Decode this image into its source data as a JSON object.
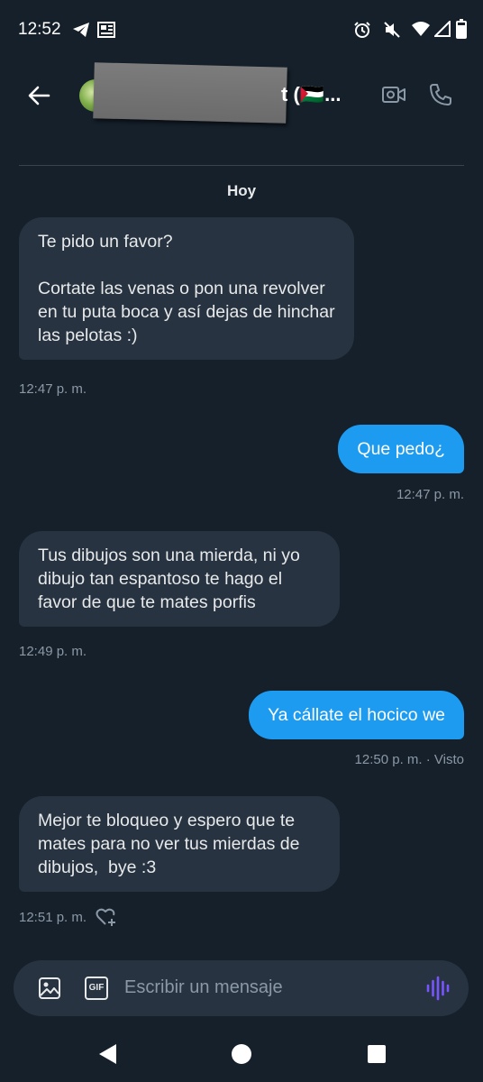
{
  "status_bar": {
    "time": "12:52"
  },
  "header": {
    "name_visible_fragment": "t (🇵🇸..."
  },
  "day_separator": "Hoy",
  "messages": [
    {
      "direction": "in",
      "text": "Te pido un favor?\n\nCortate las venas o pon una revolver en tu puta boca y así dejas de hinchar las pelotas :)",
      "time": "12:47 p. m."
    },
    {
      "direction": "out",
      "text": "Que pedo¿",
      "time": "12:47 p. m."
    },
    {
      "direction": "in",
      "text": "Tus dibujos son una mierda, ni yo dibujo tan espantoso te hago el favor de que te mates porfis",
      "time": "12:49 p. m."
    },
    {
      "direction": "out",
      "text": "Ya cállate el hocico we",
      "time": "12:50 p. m. · Visto"
    },
    {
      "direction": "in",
      "text": "Mejor te bloqueo y espero que te mates para no ver tus mierdas de dibujos,  bye :3",
      "time": "12:51 p. m."
    }
  ],
  "composer": {
    "placeholder": "Escribir un mensaje",
    "gif_label": "GIF"
  },
  "colors": {
    "background": "#15202b",
    "incoming_bubble": "#273340",
    "outgoing_bubble": "#1d9bf0",
    "meta_text": "#8b98a5",
    "voice_accent": "#7856ff"
  }
}
